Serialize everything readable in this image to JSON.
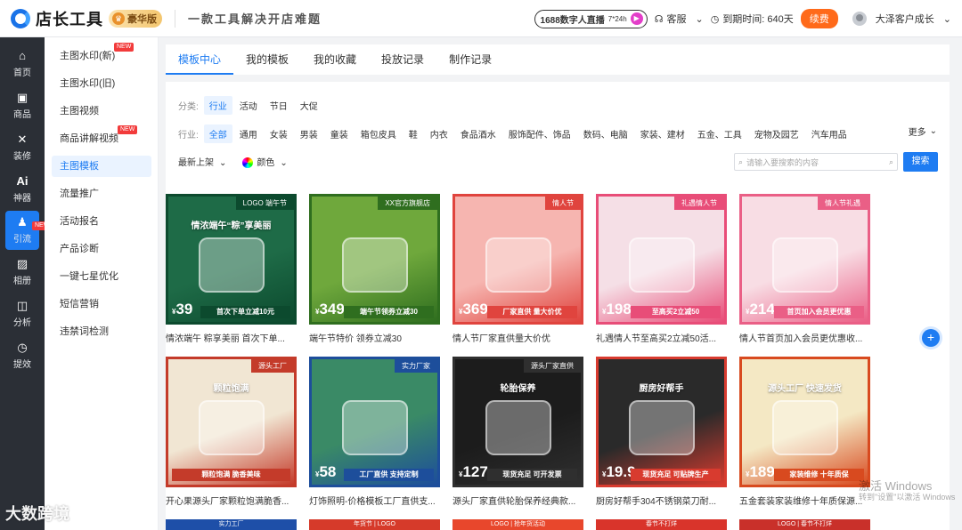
{
  "header": {
    "logo_text": "店长工具",
    "vip_label": "豪华版",
    "slogan": "一款工具解决开店难题",
    "live_text": "1688数字人直播",
    "live_sub": "7*24h",
    "service_label": "客服",
    "expire_label": "到期时间: 640天",
    "renew_label": "续费",
    "user_name": "大泽客户成长"
  },
  "rail": [
    {
      "label": "首页",
      "icon": "⌂"
    },
    {
      "label": "商品",
      "icon": "▣"
    },
    {
      "label": "装修",
      "icon": "✕"
    },
    {
      "label": "神器",
      "icon": "Ai"
    },
    {
      "label": "引流",
      "icon": "♟",
      "tag": "NEW"
    },
    {
      "label": "相册",
      "icon": "▨"
    },
    {
      "label": "分析",
      "icon": "◫"
    },
    {
      "label": "提效",
      "icon": "◷"
    }
  ],
  "submenu": [
    {
      "label": "主图水印(新)",
      "tag": "NEW"
    },
    {
      "label": "主图水印(旧)"
    },
    {
      "label": "主图视频"
    },
    {
      "label": "商品讲解视频",
      "tag": "NEW"
    },
    {
      "label": "主图模板"
    },
    {
      "label": "流量推广"
    },
    {
      "label": "活动报名"
    },
    {
      "label": "产品诊断"
    },
    {
      "label": "一键七星优化"
    },
    {
      "label": "短信营销"
    },
    {
      "label": "违禁词检测"
    }
  ],
  "tabs": [
    "模板中心",
    "我的模板",
    "我的收藏",
    "投放记录",
    "制作记录"
  ],
  "filters": {
    "category_label": "分类:",
    "categories": [
      "行业",
      "活动",
      "节日",
      "大促"
    ],
    "industry_label": "行业:",
    "industries": [
      "全部",
      "通用",
      "女装",
      "男装",
      "童装",
      "箱包皮具",
      "鞋",
      "内衣",
      "食品酒水",
      "服饰配件、饰品",
      "数码、电脑",
      "家装、建材",
      "五金、工具",
      "宠物及园艺",
      "汽车用品"
    ],
    "more_label": "更多",
    "sort_label": "最新上架",
    "color_label": "颜色",
    "search_placeholder": "请输入要搜索的内容",
    "search_button": "搜索"
  },
  "templates": [
    {
      "caption": "情浓端午 粽享美丽 首次下单...",
      "top": "LOGO 端午节",
      "headline": "情浓端午“粽”享美丽",
      "price": "39",
      "banner": "首次下单立减10元",
      "bg": "#1e6b47",
      "accent": "#0c4a2e"
    },
    {
      "caption": "端午节特价 领券立减30",
      "top": "XX官方旗舰店",
      "headline": "",
      "price": "349",
      "banner": "端午节领券立减30",
      "bg": "#6fa83c",
      "accent": "#2f6e1f"
    },
    {
      "caption": "情人节厂家直供量大价优",
      "top": "情人节",
      "headline": "",
      "price": "369",
      "banner": "厂家直供 量大价优",
      "bg": "#f6b5b0",
      "accent": "#e0443e"
    },
    {
      "caption": "礼遇情人节至高买2立减50活...",
      "top": "礼遇情人节",
      "headline": "",
      "price": "198",
      "banner": "至高买2立减50",
      "bg": "#f5dfe6",
      "accent": "#e84d78"
    },
    {
      "caption": "情人节首页加入会员更优惠收...",
      "top": "情人节礼遇",
      "headline": "",
      "price": "214",
      "banner": "首页加入会员更优惠",
      "bg": "#f8dde4",
      "accent": "#ea5f86"
    },
    {
      "caption": "开心果源头厂家颗粒饱满脆香...",
      "top": "源头工厂",
      "headline": "颗粒饱满",
      "price": "",
      "banner": "颗粒饱满 脆香美味",
      "bg": "#f1e6d3",
      "accent": "#c43b2a"
    },
    {
      "caption": "灯饰照明-价格模板工厂直供支...",
      "top": "实力厂家",
      "headline": "",
      "price": "58",
      "banner": "工厂直供 支持定制",
      "bg": "#3a8a66",
      "accent": "#1d4e9b"
    },
    {
      "caption": "源头厂家直供轮胎保养经典款...",
      "top": "源头厂家直供",
      "headline": "轮胎保养",
      "price": "127",
      "banner": "现货充足 可开发票",
      "bg": "#1c1c1c",
      "accent": "#2f2f2f"
    },
    {
      "caption": "厨房好帮手304不锈钢菜刀耐...",
      "top": "",
      "headline": "厨房好帮手",
      "price": "19.9",
      "banner": "现货充足 可贴牌生产",
      "bg": "#2a2a2a",
      "accent": "#d83b2f"
    },
    {
      "caption": "五金套装家装维修十年质保源...",
      "top": "",
      "headline": "源头工厂 快速发货",
      "price": "189",
      "banner": "家装维修 十年质保",
      "bg": "#f4e8c4",
      "accent": "#d84a1f"
    }
  ],
  "row3_tops": [
    "实力工厂",
    "年货节 | LOGO",
    "LOGO | 抢年货活动",
    "春节不打烊",
    "LOGO | 春节不打烊"
  ],
  "watermark": {
    "line1": "激活 Windows",
    "line2": "转到\"设置\"以激活 Windows",
    "corner": "大数跨境"
  }
}
